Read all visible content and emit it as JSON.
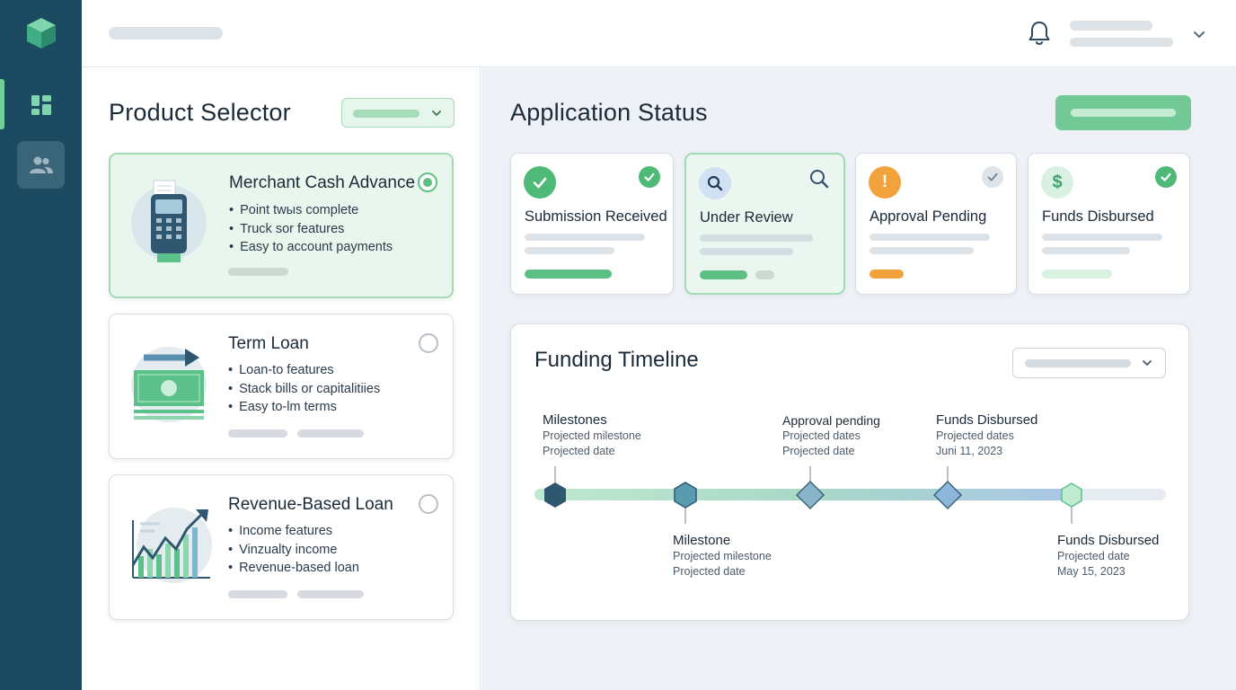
{
  "sidebar": {
    "logo": "cube-logo",
    "items": [
      {
        "name": "dashboard",
        "icon": "dashboard-icon",
        "active": true
      },
      {
        "name": "users",
        "icon": "users-icon",
        "active": false
      }
    ]
  },
  "header": {
    "icons": [
      "bell-icon",
      "chevron-down-icon"
    ]
  },
  "product_selector": {
    "title": "Product Selector",
    "products": [
      {
        "title": "Merchant Cash Advance",
        "bullets": [
          "Point twыs complete",
          "Truck sor features",
          "Easy to account payments"
        ],
        "selected": true,
        "icon": "card-terminal-icon"
      },
      {
        "title": "Term Loan",
        "bullets": [
          "Loan-to features",
          "Stack bills or capitalitiies",
          "Easy to-lm terms"
        ],
        "selected": false,
        "icon": "cash-transfer-icon"
      },
      {
        "title": "Revenue-Based Loan",
        "bullets": [
          "Income  features",
          "Vinzualty income",
          "Revenue-based loan"
        ],
        "selected": false,
        "icon": "growth-chart-icon"
      }
    ]
  },
  "application_status": {
    "title": "Application Status",
    "steps": [
      {
        "label": "Submission Received",
        "state": "complete",
        "icon": "check-icon",
        "corner_icon": "check-circle-icon",
        "color": "#4fb978"
      },
      {
        "label": "Under Review",
        "state": "active",
        "icon": "magnify-icon",
        "corner_icon": "search-icon",
        "color": "#5b8fd6"
      },
      {
        "label": "Approval Pending",
        "state": "pending",
        "icon": "exclamation-icon",
        "corner_icon": "check-circle-icon",
        "color": "#f2a23a"
      },
      {
        "label": "Funds Disbursed",
        "state": "complete",
        "icon": "dollar-icon",
        "corner_icon": "check-circle-icon",
        "color": "#4fb978"
      }
    ]
  },
  "funding_timeline": {
    "title": "Funding Timeline",
    "milestones": [
      {
        "title": "Milestones",
        "lines": [
          "Projected milestone",
          "Projected date"
        ]
      },
      {
        "title": "Milestone",
        "lines": [
          "Projected milestone",
          "Projected date"
        ]
      },
      {
        "title": "Approval pending",
        "lines": [
          "Projected dates",
          "Projected date"
        ]
      },
      {
        "title": "Funds Disbursed",
        "lines": [
          "Projected dates",
          "Juni 11, 2023"
        ]
      },
      {
        "title": "Funds Disbursed",
        "lines": [
          "Projected date",
          "May 15, 2023"
        ]
      }
    ]
  },
  "colors": {
    "sidebar": "#1c4a60",
    "accent_green": "#72c995",
    "pending_orange": "#f2a23a",
    "review_blue": "#5b8fd6"
  }
}
